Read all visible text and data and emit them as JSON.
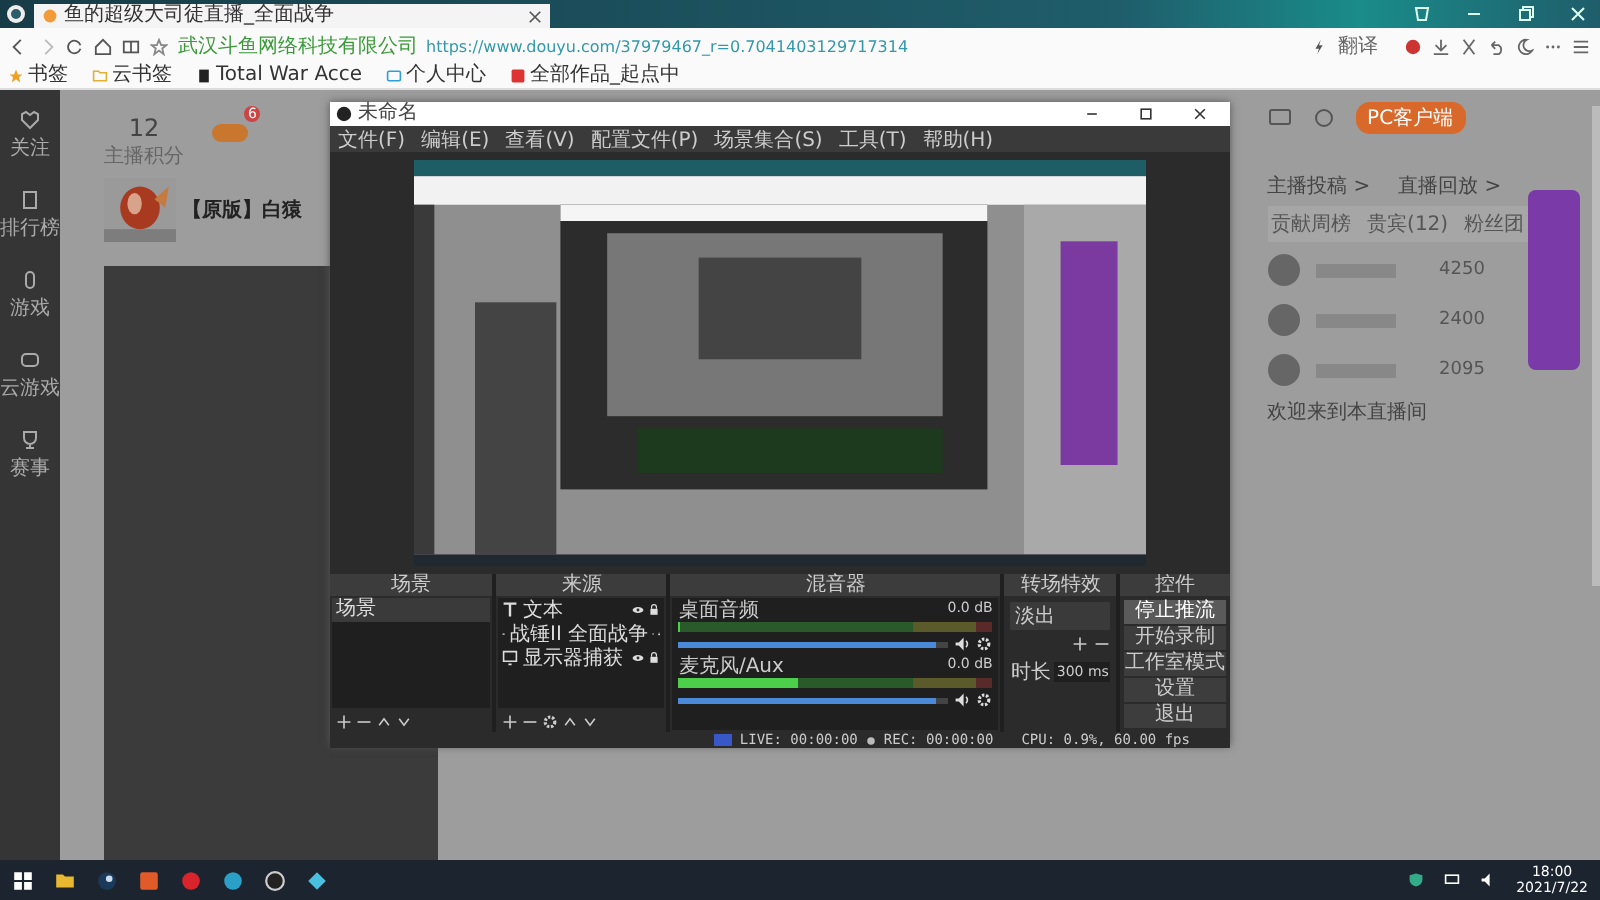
{
  "browser": {
    "tab_title": "鱼的超级大司徒直播_全面战争",
    "url_owner": "武汉斗鱼网络科技有限公司",
    "url": "https://www.douyu.com/37979467_r=0.7041403129717314",
    "translate": "翻译",
    "bookmarks": [
      {
        "label": "书签",
        "kind": "star"
      },
      {
        "label": "云书签",
        "kind": "folder"
      },
      {
        "label": "Total War Acce",
        "kind": "page"
      },
      {
        "label": "个人中心",
        "kind": "tv"
      },
      {
        "label": "全部作品_起点中",
        "kind": "book"
      }
    ]
  },
  "page": {
    "sidebar": [
      {
        "label": "关注",
        "kind": "heart"
      },
      {
        "label": "排行榜",
        "kind": "book"
      },
      {
        "label": "游戏",
        "kind": "phone"
      },
      {
        "label": "云游戏",
        "kind": "pad"
      },
      {
        "label": "赛事",
        "kind": "cup"
      }
    ],
    "stat": {
      "value": "12",
      "label": "主播积分"
    },
    "badge": "6",
    "room_title": "【原版】白猿",
    "right": {
      "client_button": "PC客户端",
      "links": [
        "主播投稿 >",
        "直播回放 >"
      ],
      "tabs": [
        "贡献周榜",
        "贵宾(12)",
        "粉丝团"
      ],
      "ranks": [
        {
          "value": "4250"
        },
        {
          "value": "2400"
        },
        {
          "value": "2095"
        }
      ],
      "chat": "欢迎来到本直播间"
    }
  },
  "obs": {
    "title": "未命名",
    "menu": [
      "文件(F)",
      "编辑(E)",
      "查看(V)",
      "配置文件(P)",
      "场景集合(S)",
      "工具(T)",
      "帮助(H)"
    ],
    "docks": {
      "scenes": "场景",
      "sources": "来源",
      "mixer": "混音器",
      "transitions": "转场特效",
      "controls": "控件"
    },
    "scenes": [
      {
        "label": "场景",
        "selected": true
      }
    ],
    "sources": [
      {
        "label": "文本",
        "kind": "text"
      },
      {
        "label": "战锤II 全面战争",
        "kind": "game"
      },
      {
        "label": "显示器捕获",
        "kind": "monitor"
      }
    ],
    "channels": [
      {
        "name": "桌面音频",
        "reading": "0.0 dB",
        "level": 0.0,
        "fader": {
          "level": 0.95
        }
      },
      {
        "name": "麦克风/Aux",
        "reading": "0.0 dB",
        "level": 0.38,
        "fader": {
          "level": 0.95
        }
      }
    ],
    "transition": {
      "value": "淡出",
      "duration_label": "时长",
      "duration": "300 ms"
    },
    "controls": [
      {
        "label": "停止推流",
        "active": true
      },
      {
        "label": "开始录制",
        "active": false
      },
      {
        "label": "工作室模式",
        "active": false
      },
      {
        "label": "设置",
        "active": false
      },
      {
        "label": "退出",
        "active": false
      }
    ],
    "status": {
      "live": "LIVE: 00:00:00",
      "rec": "REC: 00:00:00",
      "cpu": "CPU: 0.9%, 60.00 fps"
    }
  },
  "taskbar": {
    "time": "18:00",
    "date": "2021/7/22"
  }
}
